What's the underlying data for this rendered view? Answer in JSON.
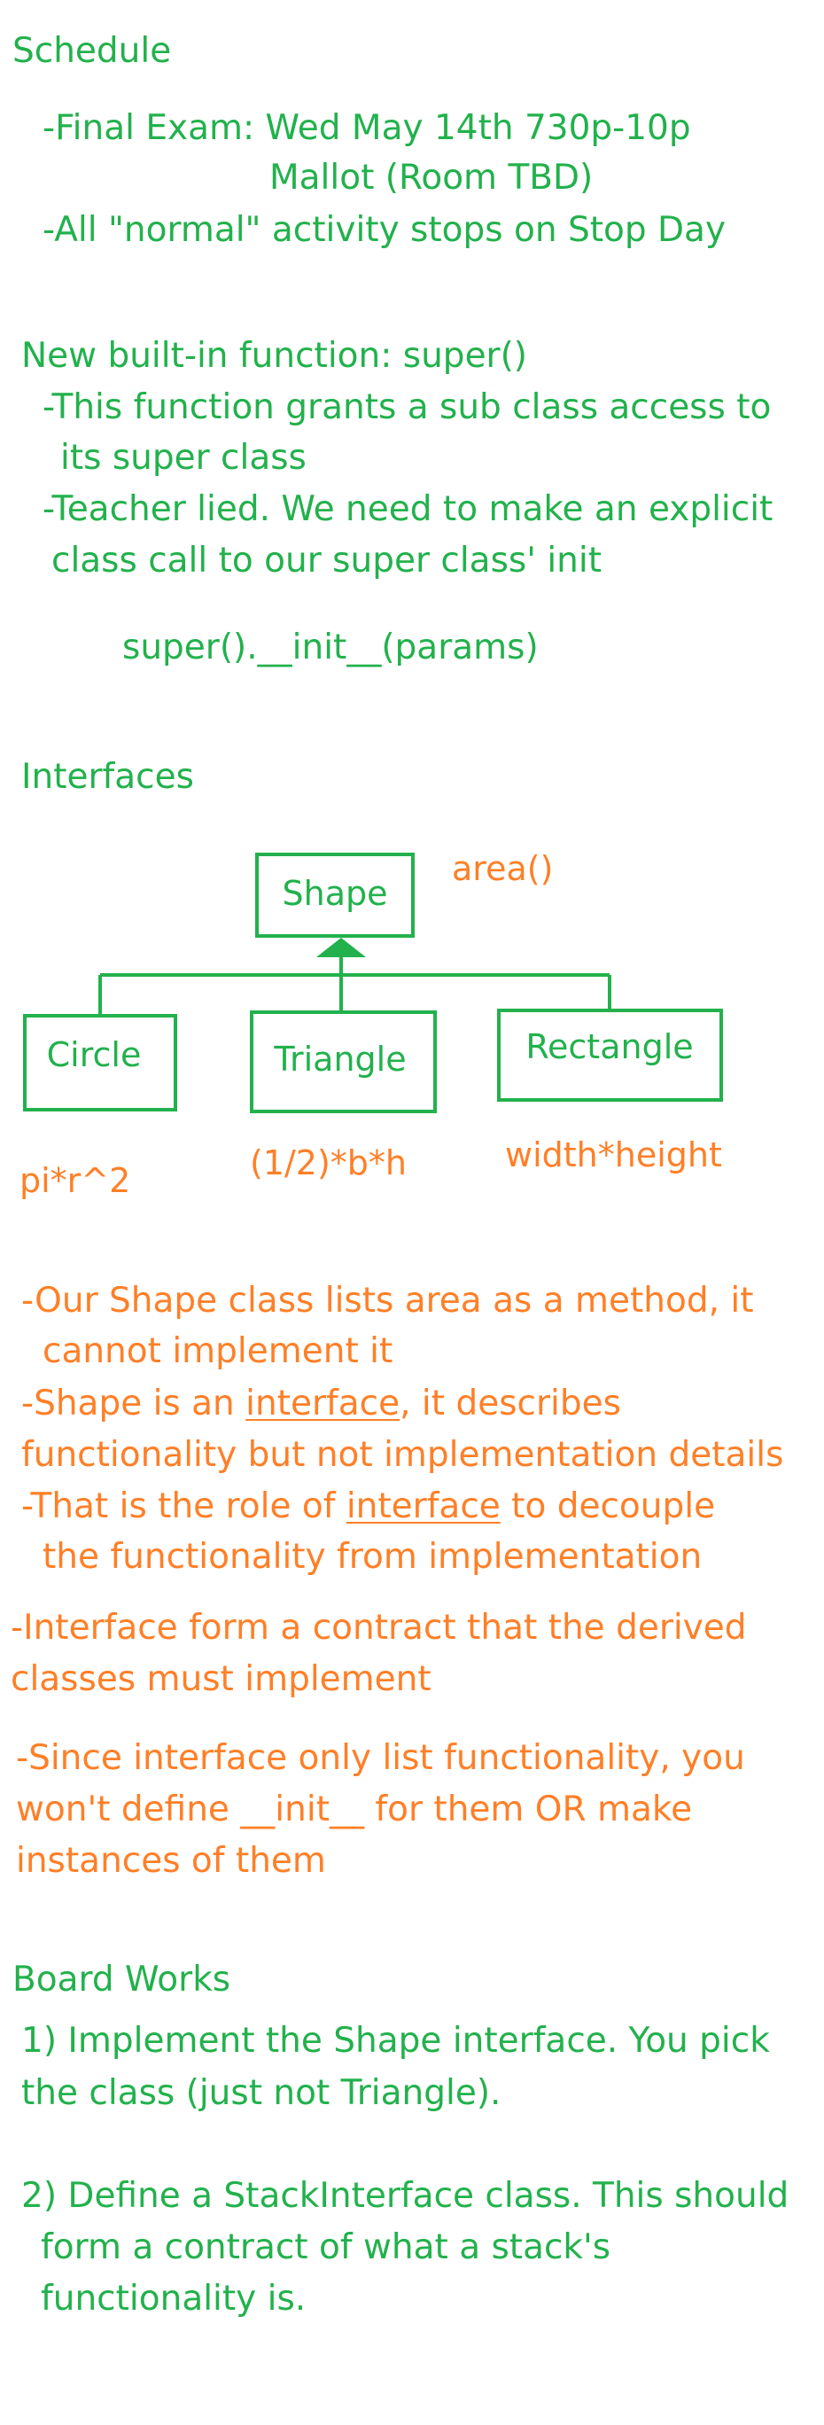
{
  "colors": {
    "green": "#22b14c",
    "orange": "#ff7f27"
  },
  "schedule": {
    "heading": "Schedule",
    "final_exam": "-Final Exam: Wed May 14th 730p-10p",
    "location": "Mallot (Room TBD)",
    "stop_day": "-All \"normal\" activity stops on Stop Day"
  },
  "super_section": {
    "heading": "New built-in function: super()",
    "line1": "-This function grants a sub class access to",
    "line2": "its super class",
    "line3": "-Teacher lied. We need to make an explicit",
    "line4": "class call to our super class' init",
    "code": "super().__init__(params)"
  },
  "interfaces": {
    "heading": "Interfaces",
    "diagram": {
      "parent": "Shape",
      "method": "area()",
      "children": [
        "Circle",
        "Triangle",
        "Rectangle"
      ],
      "formulas": [
        "pi*r^2",
        "(1/2)*b*h",
        "width*height"
      ]
    },
    "notes": {
      "n1a": "-Our Shape class lists area as a method, it",
      "n1b": "cannot implement it",
      "n2a_pre": "-Shape is an ",
      "n2a_u": "interface",
      "n2a_post": ", it describes",
      "n2b": "functionality but not implementation details",
      "n3a_pre": "-That is the role of ",
      "n3a_u": "interface",
      "n3a_post": " to decouple",
      "n3b": "the functionality from implementation",
      "n4a": "-Interface form a contract that the derived",
      "n4b": "classes must implement",
      "n5a": "-Since interface only list functionality, you",
      "n5b": "won't define __init__ for them OR make",
      "n5c": "instances of them"
    }
  },
  "board_works": {
    "heading": "Board Works",
    "item1a": "1) Implement the Shape interface. You pick",
    "item1b": "the class (just not Triangle).",
    "item2a": "2) Define a StackInterface class. This should",
    "item2b": "form a contract of what a stack's",
    "item2c": "functionality is."
  }
}
